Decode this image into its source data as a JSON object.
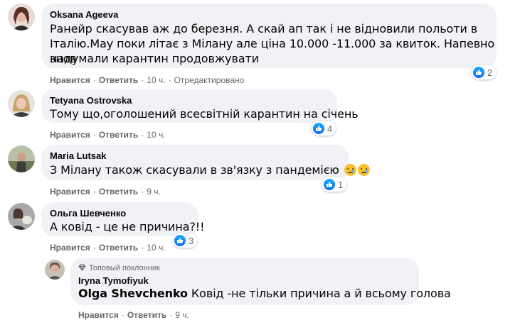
{
  "comments": [
    {
      "author": "Oksana Ageeva",
      "text_lines": [
        "Ранейр скасував аж до березня. А скай ап так і не відновили польоти в",
        "Італію.Мау поки літає з Мілану але ціна 10.000 -11.000 за квиток. Напевно знов",
        "надумали карантин продовжувати"
      ],
      "like_label": "Нравится",
      "reply_label": "Ответить",
      "time": "10 ч.",
      "edited": "Отредактировано",
      "reactions": "2"
    },
    {
      "author": "Tetyana Ostrovska",
      "text_lines": [
        "Тому що,оголошений всесвітній карантин на січень"
      ],
      "like_label": "Нравится",
      "reply_label": "Ответить",
      "time": "10 ч.",
      "reactions": "4"
    },
    {
      "author": "Maria Lutsak",
      "text_lines": [
        "З Мілану також скасували в зв'язку з пандемією"
      ],
      "like_label": "Нравится",
      "reply_label": "Ответить",
      "time": "9 ч.",
      "reactions": "1"
    },
    {
      "author": "Ольга Шевченко",
      "text_lines": [
        "А ковід - це не причина?!!"
      ],
      "like_label": "Нравится",
      "reply_label": "Ответить",
      "time": "10 ч.",
      "reactions": "3"
    }
  ],
  "reply": {
    "badge": "Топовый поклонник",
    "author": "Iryna Tymofiyuk",
    "mention": "Olga Shevchenko",
    "text": " Ковід -не тільки причина а й всьому голова",
    "like_label": "Нравится",
    "reply_label": "Ответить",
    "time": "9 ч."
  },
  "colors": {
    "bubble": "#f0f2f5",
    "meta": "#65676b",
    "like_blue": "#0866ff"
  }
}
